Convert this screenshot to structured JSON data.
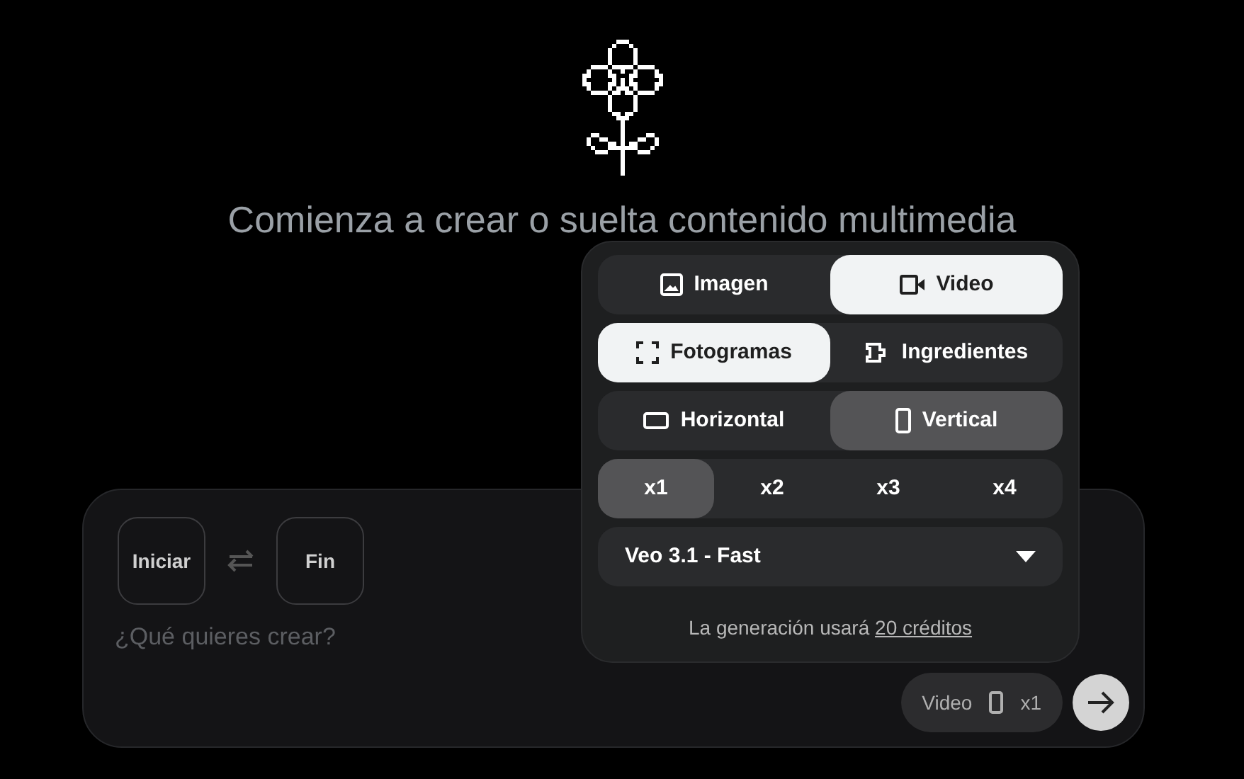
{
  "heading": "Comienza a crear o suelta contenido multimedia",
  "prompt": {
    "start_button": "Iniciar",
    "end_button": "Fin",
    "placeholder": "¿Qué quieres crear?",
    "summary_chip": [
      "Video",
      "x1"
    ]
  },
  "settings_popup": {
    "groups": [
      {
        "kind": "primary",
        "options": [
          {
            "label": "Imagen",
            "selected": false
          },
          {
            "label": "Video",
            "selected": true
          }
        ]
      },
      {
        "kind": "primary",
        "options": [
          {
            "label": "Fotogramas",
            "selected": true
          },
          {
            "label": "Ingredientes",
            "selected": false
          }
        ]
      },
      {
        "kind": "secondary",
        "options": [
          {
            "label": "Horizontal",
            "selected": false
          },
          {
            "label": "Vertical",
            "selected": true
          }
        ]
      },
      {
        "kind": "secondary",
        "options": [
          {
            "label": "x1",
            "selected": true
          },
          {
            "label": "x2",
            "selected": false
          },
          {
            "label": "x3",
            "selected": false
          },
          {
            "label": "x4",
            "selected": false
          }
        ]
      }
    ],
    "model_dropdown": "Veo 3.1 - Fast",
    "credits_text": "La generación usará",
    "credits_link": "20 créditos"
  }
}
